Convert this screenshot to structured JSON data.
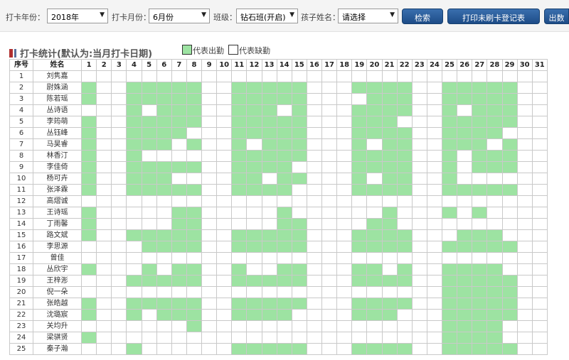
{
  "filters": {
    "year_label": "打卡年份：",
    "year_value": "2018年",
    "month_label": "打卡月份：",
    "month_value": "6月份",
    "class_label": "班级：",
    "class_value": "钻石班(开启)",
    "child_label": "孩子姓名：",
    "child_value": "请选择"
  },
  "buttons": {
    "search": "检索",
    "print": "打印未刷卡登记表",
    "export": "出数"
  },
  "section": {
    "title": "打卡统计(默认为:当月打卡日期)",
    "legend_present": "代表出勤",
    "legend_absent": "代表缺勤"
  },
  "colors": {
    "present": "#9de3a2",
    "absent": "#ffffff",
    "button": "#1d4c87"
  },
  "table": {
    "header_seq": "序号",
    "header_name": "姓名",
    "days": [
      "1",
      "2",
      "3",
      "4",
      "5",
      "6",
      "7",
      "8",
      "9",
      "10",
      "11",
      "12",
      "13",
      "14",
      "15",
      "16",
      "17",
      "18",
      "19",
      "20",
      "21",
      "22",
      "23",
      "24",
      "25",
      "26",
      "27",
      "28",
      "29",
      "30",
      "31"
    ],
    "rows": [
      {
        "seq": "1",
        "name": "刘隽嘉",
        "attendance": "0000000000000000000000000000000"
      },
      {
        "seq": "2",
        "name": "尉姝涵",
        "attendance": "1001111100111110001111001111100"
      },
      {
        "seq": "3",
        "name": "陈若瑶",
        "attendance": "1001111100111110000111001111100"
      },
      {
        "seq": "4",
        "name": "丛诗语",
        "attendance": "0001011100111010001111001011100"
      },
      {
        "seq": "5",
        "name": "李筠萌",
        "attendance": "1001111100111110001110001111100"
      },
      {
        "seq": "6",
        "name": "丛钰峰",
        "attendance": "1001111000111110001111001111000"
      },
      {
        "seq": "7",
        "name": "马昊睿",
        "attendance": "1001110100101110001011001110100"
      },
      {
        "seq": "8",
        "name": "林香汀",
        "attendance": "1001000000111110001111001011100"
      },
      {
        "seq": "9",
        "name": "李佳倚",
        "attendance": "1001111100111100001111001011100"
      },
      {
        "seq": "10",
        "name": "杨可卉",
        "attendance": "1001110000110110001011001000000"
      },
      {
        "seq": "11",
        "name": "张泽霖",
        "attendance": "1001111100111100001111001111100"
      },
      {
        "seq": "12",
        "name": "高熠诚",
        "attendance": "0000000000000000000000000000000"
      },
      {
        "seq": "13",
        "name": "王诗瑶",
        "attendance": "1000001100000100000010001010000"
      },
      {
        "seq": "14",
        "name": "丁雨馨",
        "attendance": "1000001100000110000110000000000"
      },
      {
        "seq": "15",
        "name": "路文斌",
        "attendance": "1001111100111110001111000111000"
      },
      {
        "seq": "16",
        "name": "李思源",
        "attendance": "0000111100111110001111001111100"
      },
      {
        "seq": "17",
        "name": "曾佳",
        "attendance": "0000000000000000000000000000000"
      },
      {
        "seq": "18",
        "name": "丛欣宇",
        "attendance": "1000101100100110001101001111000"
      },
      {
        "seq": "19",
        "name": "王梓浵",
        "attendance": "0001111100111110001111001111100"
      },
      {
        "seq": "20",
        "name": "倪一朵",
        "attendance": "0000000000000000000000001111100"
      },
      {
        "seq": "21",
        "name": "张皓越",
        "attendance": "1001111100111110001111001111100"
      },
      {
        "seq": "22",
        "name": "沈璐宸",
        "attendance": "1001011100111100001110001111100"
      },
      {
        "seq": "23",
        "name": "关均升",
        "attendance": "0000000100000000000000001111000"
      },
      {
        "seq": "24",
        "name": "梁骐贤",
        "attendance": "1000000000000000000000001111000"
      },
      {
        "seq": "25",
        "name": "秦子瀚",
        "attendance": "0001000000111110001111001111100"
      }
    ]
  }
}
